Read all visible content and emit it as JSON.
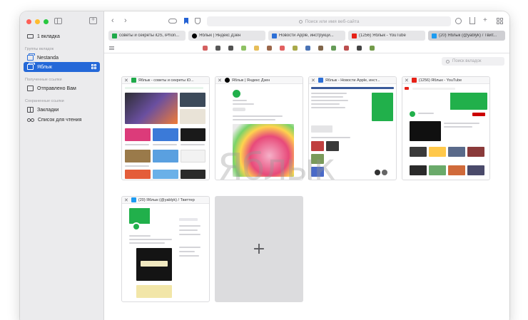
{
  "sidebar": {
    "current_tabs": {
      "label": "1 вкладка",
      "icon": "monitor-icon"
    },
    "groups_header": "Группы вкладок",
    "groups": [
      {
        "label": "Nestanda",
        "icon": "tabs-icon",
        "active": false
      },
      {
        "label": "Яблык",
        "icon": "tabs-icon",
        "active": true
      }
    ],
    "received_header": "Полученные ссылки",
    "received": [
      {
        "label": "Отправлено Вам",
        "icon": "inbox-icon"
      }
    ],
    "saved_header": "Сохраненные ссылки",
    "saved": [
      {
        "label": "Закладки",
        "icon": "book-icon"
      },
      {
        "label": "Список для чтения",
        "icon": "glasses-icon"
      }
    ]
  },
  "toolbar": {
    "address_placeholder": "Поиск или имя веб-сайта",
    "back_glyph": "‹",
    "forward_glyph": "›",
    "new_tab_glyph": "+"
  },
  "tabs": [
    {
      "label": "советы и секреты iOS, iPhon...",
      "favicon_color": "#1faa4a",
      "active": false
    },
    {
      "label": "Яблык | Яндекс Дзен",
      "favicon_color": "#000000",
      "active": false
    },
    {
      "label": "Новости Apple, инструкци...",
      "favicon_color": "#2c6fd6",
      "active": false
    },
    {
      "label": "(1256) Яблык - YouTube",
      "favicon_color": "#e62117",
      "active": false
    },
    {
      "label": "(20) Яблык (@yablyk) / Твит...",
      "favicon_color": "#1d9bf0",
      "active": true
    }
  ],
  "search_tabs_placeholder": "Поиск вкладок",
  "thumbnails": [
    {
      "title": "Яблык - советы и секреты iO...",
      "favicon_color": "#1faa4a",
      "close": "✕"
    },
    {
      "title": "Яблык | Яндекс Дзен",
      "favicon_color": "#000000",
      "close": "✕"
    },
    {
      "title": "Яблык - Новости Apple, инст...",
      "favicon_color": "#2c6fd6",
      "close": "✕"
    },
    {
      "title": "(1256) Яблык - YouTube",
      "favicon_color": "#e62117",
      "close": "✕"
    },
    {
      "title": "(20) Яблык (@yablyk) / Твиттер",
      "favicon_color": "#1d9bf0",
      "close": "✕"
    }
  ],
  "new_tab_tile": "+",
  "watermark": "Яблык",
  "colors": {
    "accent": "#2468d8",
    "brand_green": "#21b04b"
  }
}
